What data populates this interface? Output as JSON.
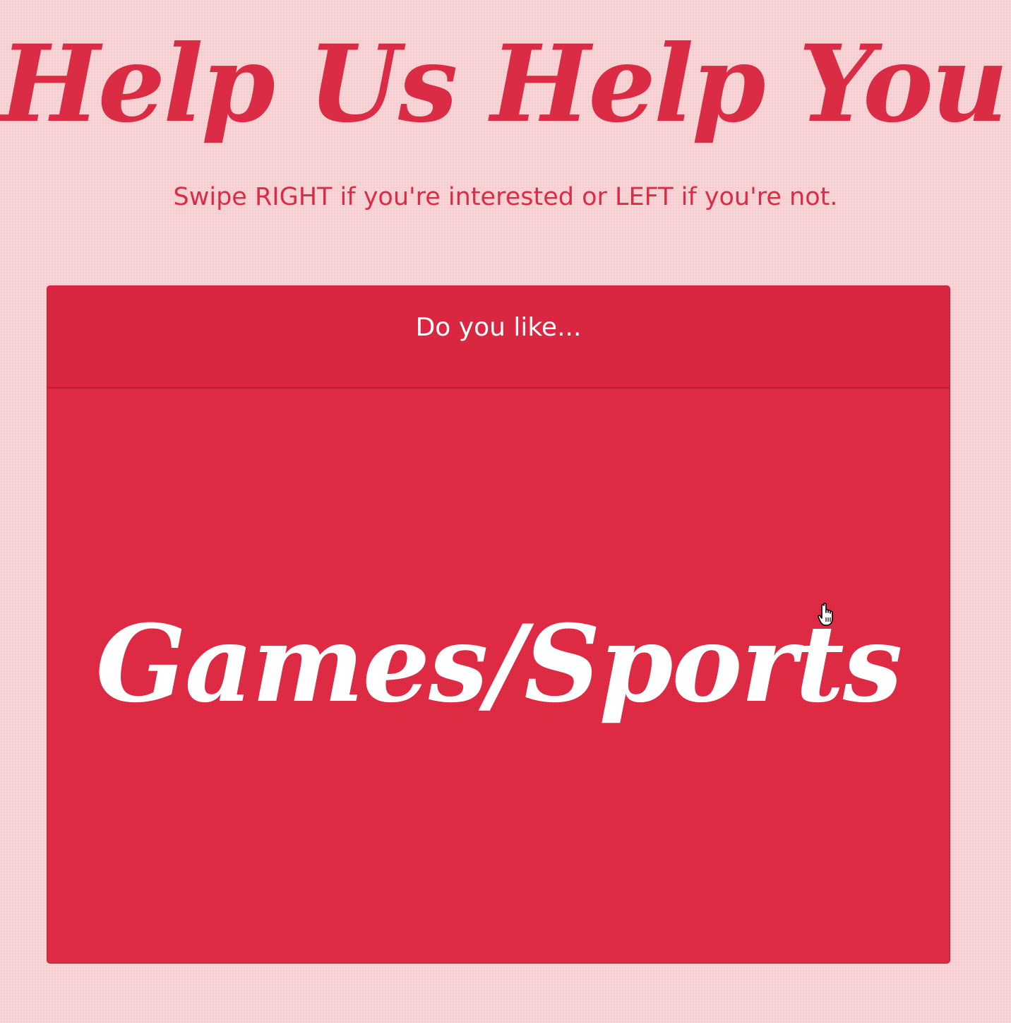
{
  "header": {
    "title": "Help Us Help You!",
    "subtitle": "Swipe RIGHT if you're interested or LEFT if you're not."
  },
  "card": {
    "question": "Do you like...",
    "topic": "Games/Sports"
  },
  "cursor": {
    "icon": "hand-pointer-icon"
  },
  "colors": {
    "background": "#f7d4d5",
    "accent": "#db2c45",
    "card": "#e02b45",
    "card_text": "#ffffff"
  }
}
